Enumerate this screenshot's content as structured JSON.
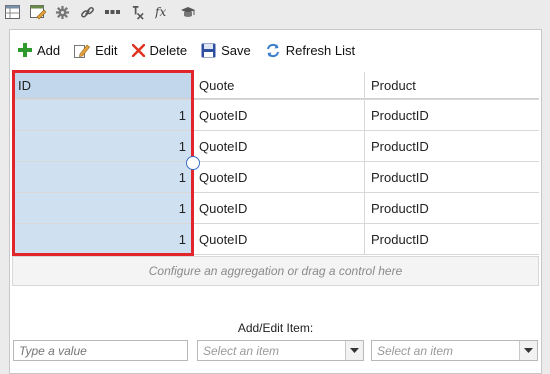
{
  "top_toolbar": {
    "icons": [
      "grid-settings-icon",
      "edit-window-icon",
      "gear-icon",
      "link-icon",
      "more-icon",
      "clear-format-icon",
      "function-icon",
      "graduation-cap-icon"
    ]
  },
  "grid_toolbar": {
    "add_label": "Add",
    "edit_label": "Edit",
    "delete_label": "Delete",
    "save_label": "Save",
    "refresh_label": "Refresh List"
  },
  "table": {
    "columns": [
      "ID",
      "Quote",
      "Product"
    ],
    "rows": [
      {
        "id": "1",
        "quote": "QuoteID",
        "product": "ProductID"
      },
      {
        "id": "1",
        "quote": "QuoteID",
        "product": "ProductID"
      },
      {
        "id": "1",
        "quote": "QuoteID",
        "product": "ProductID"
      },
      {
        "id": "1",
        "quote": "QuoteID",
        "product": "ProductID"
      },
      {
        "id": "1",
        "quote": "QuoteID",
        "product": "ProductID"
      }
    ]
  },
  "aggregation_text": "Configure an aggregation or drag a control here",
  "add_edit": {
    "title": "Add/Edit Item:",
    "value_placeholder": "Type a value",
    "select1_placeholder": "Select an item",
    "select2_placeholder": "Select an item"
  },
  "colors": {
    "selection_outline": "#e2252b",
    "selected_column_bg": "#cfe0f1",
    "add_icon": "#2e9a2e",
    "delete_icon": "#e0301e",
    "save_icon": "#2f4fa0"
  }
}
